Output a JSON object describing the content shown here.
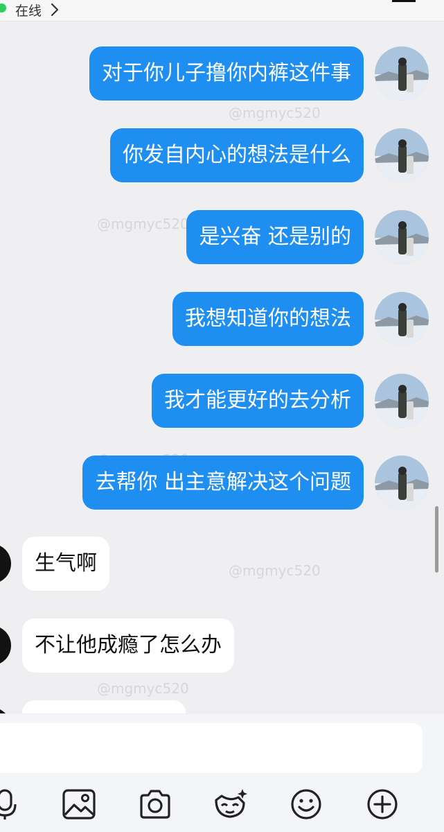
{
  "header": {
    "status_text": "在线"
  },
  "messages": [
    {
      "side": "out",
      "text": "对于你儿子撸你内裤这件事"
    },
    {
      "side": "out",
      "text": "你发自内心的想法是什么"
    },
    {
      "side": "out",
      "text": "是兴奋 还是别的"
    },
    {
      "side": "out",
      "text": "我想知道你的想法"
    },
    {
      "side": "out",
      "text": "我才能更好的去分析"
    },
    {
      "side": "out",
      "text": "去帮你 出主意解决这个问题"
    },
    {
      "side": "in",
      "text": "生气啊"
    },
    {
      "side": "in",
      "text": "不让他成瘾了怎么办"
    },
    {
      "side": "in",
      "text": ""
    }
  ],
  "watermark": "@mgmyc520",
  "toolbar": {
    "icons": [
      "microphone-icon",
      "image-icon",
      "camera-icon",
      "sticker-icon",
      "emoji-icon",
      "add-icon"
    ]
  },
  "colors": {
    "outgoing_bubble": "#1e8ff0",
    "incoming_bubble": "#ffffff",
    "online": "#2fd05a"
  }
}
